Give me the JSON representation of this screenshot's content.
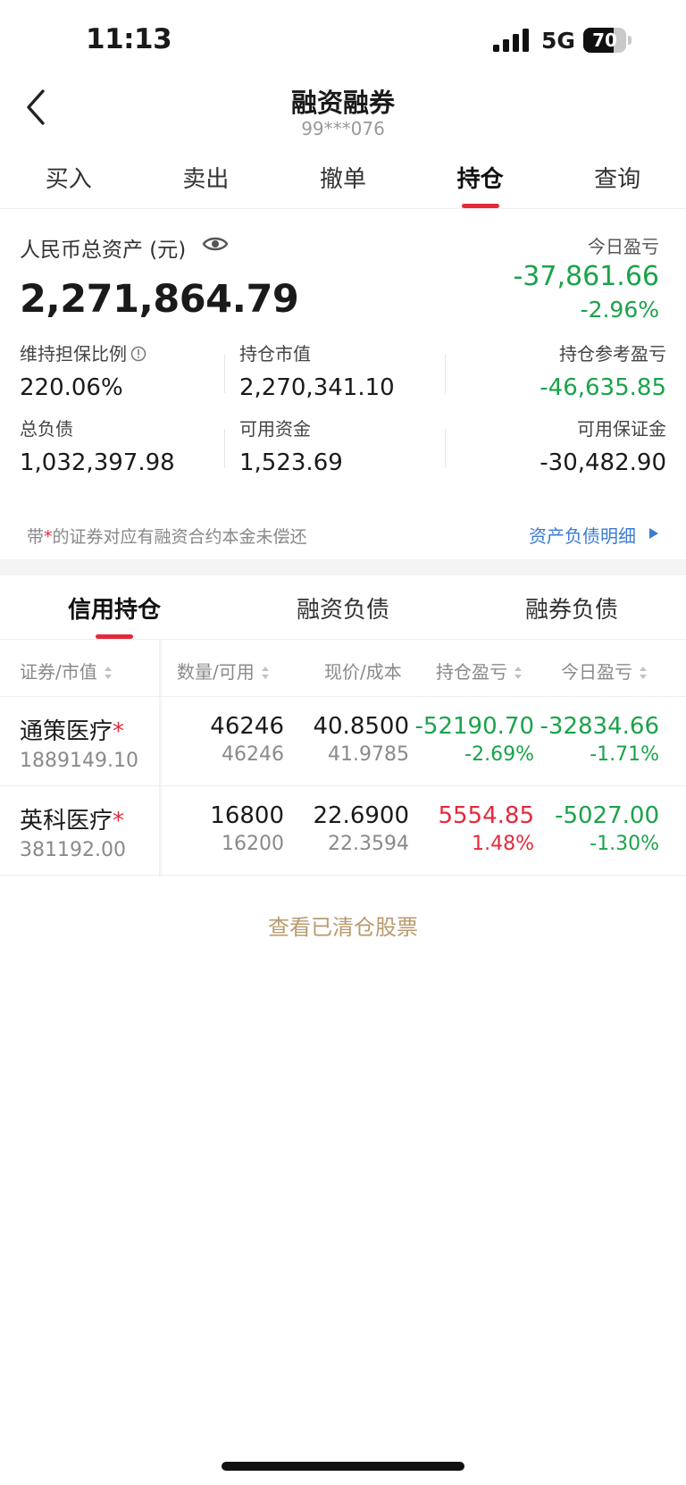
{
  "status_bar": {
    "time": "11:13",
    "network": "5G",
    "battery": "70",
    "battery_level": 0.7
  },
  "header": {
    "title": "融资融券",
    "account": "99***076"
  },
  "trade_tabs": [
    {
      "label": "买入"
    },
    {
      "label": "卖出"
    },
    {
      "label": "撤单"
    },
    {
      "label": "持仓",
      "active": true
    },
    {
      "label": "查询"
    }
  ],
  "assets": {
    "total_label": "人民币总资产 (元)",
    "total_value": "2,271,864.79",
    "today_pl_label": "今日盈亏",
    "today_pl_value": "-37,861.66",
    "today_pl_pct": "-2.96%",
    "metrics": {
      "ratio": {
        "label": "维持担保比例",
        "value": "220.06%"
      },
      "market_value": {
        "label": "持仓市值",
        "value": "2,270,341.10"
      },
      "ref_pl": {
        "label": "持仓参考盈亏",
        "value": "-46,635.85"
      },
      "liabilities": {
        "label": "总负债",
        "value": "1,032,397.98"
      },
      "available_cash": {
        "label": "可用资金",
        "value": "1,523.69"
      },
      "available_margin": {
        "label": "可用保证金",
        "value": "-30,482.90"
      }
    },
    "note_prefix": "带",
    "note_star": "*",
    "note_suffix": "的证券对应有融资合约本金未偿还",
    "detail_link": "资产负债明细"
  },
  "holding_tabs": [
    {
      "label": "信用持仓",
      "active": true
    },
    {
      "label": "融资负债"
    },
    {
      "label": "融券负债"
    }
  ],
  "table": {
    "headers": {
      "security": "证券/市值",
      "quantity": "数量/可用",
      "price": "现价/成本",
      "holding_pl": "持仓盈亏",
      "today_pl": "今日盈亏"
    },
    "rows": [
      {
        "name": "通策医疗",
        "star": "*",
        "market_value": "1889149.10",
        "quantity": "46246",
        "available": "46246",
        "price": "40.8500",
        "cost": "41.9785",
        "holding_pl": "-52190.70",
        "holding_pl_pct": "-2.69%",
        "today_pl": "-32834.66",
        "today_pl_pct": "-1.71%"
      },
      {
        "name": "英科医疗",
        "star": "*",
        "market_value": "381192.00",
        "quantity": "16800",
        "available": "16200",
        "price": "22.6900",
        "cost": "22.3594",
        "holding_pl": "5554.85",
        "holding_pl_pct": "1.48%",
        "today_pl": "-5027.00",
        "today_pl_pct": "-1.30%"
      }
    ]
  },
  "cleared_link": "查看已清仓股票",
  "colors": {
    "up": "#e5293a",
    "down": "#1aa34a",
    "link": "#3a7bd5",
    "accent": "#e5293a",
    "gold": "#b89a6e"
  }
}
